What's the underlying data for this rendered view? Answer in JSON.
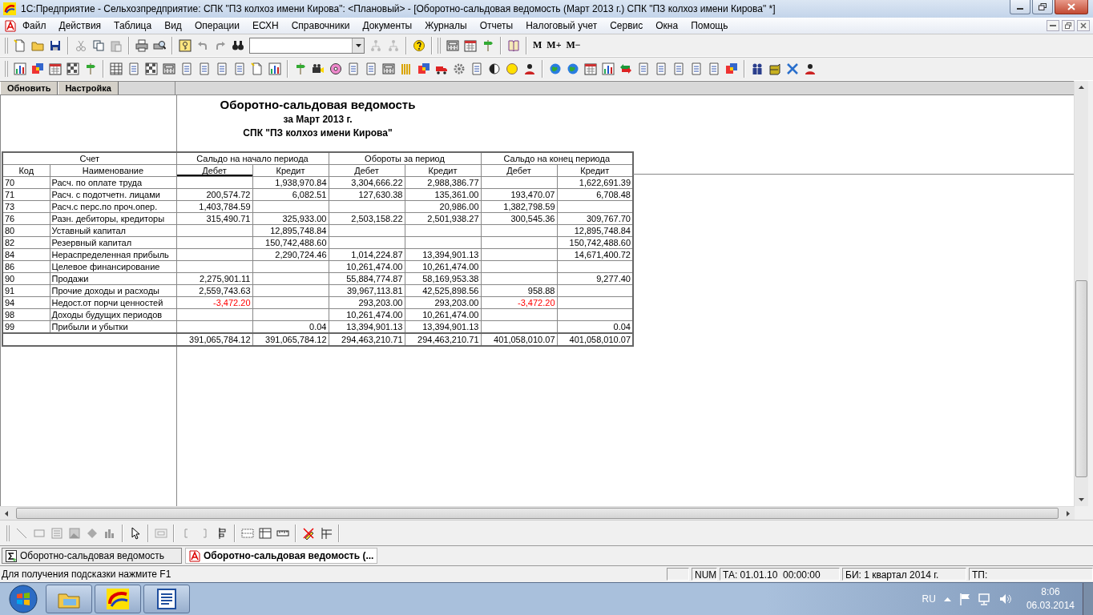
{
  "window": {
    "title": "1С:Предприятие - Сельхозпредприятие: СПК \"ПЗ колхоз имени Кирова\": <Плановый> - [Оборотно-сальдовая ведомость (Март 2013 г.) СПК \"ПЗ колхоз имени Кирова\"  *]"
  },
  "menu": [
    "Файл",
    "Действия",
    "Таблица",
    "Вид",
    "Операции",
    "ЕСХН",
    "Справочники",
    "Документы",
    "Журналы",
    "Отчеты",
    "Налоговый учет",
    "Сервис",
    "Окна",
    "Помощь"
  ],
  "memory_buttons": [
    "M",
    "M+",
    "M−"
  ],
  "report_buttons": [
    "Обновить",
    "Настройка"
  ],
  "report": {
    "title": "Оборотно-сальдовая ведомость",
    "period": "за Март 2013 г.",
    "organization": "СПК \"ПЗ колхоз имени Кирова\"",
    "header_groups": [
      "Счет",
      "Сальдо на начало периода",
      "Обороты за период",
      "Сальдо на конец периода"
    ],
    "columns": [
      {
        "label": "Код",
        "selected": false
      },
      {
        "label": "Наименование",
        "selected": false
      },
      {
        "label": "Дебет",
        "selected": true
      },
      {
        "label": "Кредит",
        "selected": false
      },
      {
        "label": "Дебет",
        "selected": false
      },
      {
        "label": "Кредит",
        "selected": false
      },
      {
        "label": "Дебет",
        "selected": false
      },
      {
        "label": "Кредит",
        "selected": false
      }
    ],
    "rows": [
      {
        "code": "70",
        "name": "Расч. по оплате труда",
        "opening_credit": "1,938,970.84",
        "turnover_debit": "3,304,666.22",
        "turnover_credit": "2,988,386.77",
        "closing_credit": "1,622,691.39"
      },
      {
        "code": "71",
        "name": "Расч. с подотчетн. лицами",
        "opening_debit": "200,574.72",
        "opening_credit": "6,082.51",
        "turnover_debit": "127,630.38",
        "turnover_credit": "135,361.00",
        "closing_debit": "193,470.07",
        "closing_credit": "6,708.48"
      },
      {
        "code": "73",
        "name": "Расч.с перс.по проч.опер.",
        "opening_debit": "1,403,784.59",
        "turnover_credit": "20,986.00",
        "closing_debit": "1,382,798.59"
      },
      {
        "code": "76",
        "name": "Разн. дебиторы, кредиторы",
        "opening_debit": "315,490.71",
        "opening_credit": "325,933.00",
        "turnover_debit": "2,503,158.22",
        "turnover_credit": "2,501,938.27",
        "closing_debit": "300,545.36",
        "closing_credit": "309,767.70"
      },
      {
        "code": "80",
        "name": "Уставный капитал",
        "opening_credit": "12,895,748.84",
        "closing_credit": "12,895,748.84"
      },
      {
        "code": "82",
        "name": "Резервный капитал",
        "opening_credit": "150,742,488.60",
        "closing_credit": "150,742,488.60"
      },
      {
        "code": "84",
        "name": "Нераспределенная прибыль",
        "opening_credit": "2,290,724.46",
        "turnover_debit": "1,014,224.87",
        "turnover_credit": "13,394,901.13",
        "closing_credit": "14,671,400.72"
      },
      {
        "code": "86",
        "name": "Целевое финансирование",
        "turnover_debit": "10,261,474.00",
        "turnover_credit": "10,261,474.00"
      },
      {
        "code": "90",
        "name": "Продажи",
        "opening_debit": "2,275,901.11",
        "turnover_debit": "55,884,774.87",
        "turnover_credit": "58,169,953.38",
        "closing_credit": "9,277.40"
      },
      {
        "code": "91",
        "name": "Прочие доходы и расходы",
        "opening_debit": "2,559,743.63",
        "turnover_debit": "39,967,113.81",
        "turnover_credit": "42,525,898.56",
        "closing_debit": "958.88"
      },
      {
        "code": "94",
        "name": "Недост.от порчи ценностей",
        "opening_debit": "-3,472.20",
        "turnover_debit": "293,203.00",
        "turnover_credit": "293,203.00",
        "closing_debit": "-3,472.20",
        "negative": {
          "opening_debit": true,
          "closing_debit": true
        }
      },
      {
        "code": "98",
        "name": "Доходы будущих периодов",
        "turnover_debit": "10,261,474.00",
        "turnover_credit": "10,261,474.00"
      },
      {
        "code": "99",
        "name": "Прибыли и убытки",
        "opening_credit": "0.04",
        "turnover_debit": "13,394,901.13",
        "turnover_credit": "13,394,901.13",
        "closing_credit": "0.04"
      }
    ],
    "totals": [
      "391,065,784.12",
      "391,065,784.12",
      "294,463,210.71",
      "294,463,210.71",
      "401,058,010.07",
      "401,058,010.07"
    ]
  },
  "window_tabs": [
    {
      "label": "Оборотно-сальдовая ведомость",
      "selected": false
    },
    {
      "label": "Оборотно-сальдовая ведомость (...",
      "selected": true
    }
  ],
  "status_bar": {
    "hint": "Для получения подсказки нажмите F1",
    "fields": [
      "NUM",
      "ТА: 01.01.10  00:00:00",
      "БИ: 1 квартал 2014 г.",
      "ТП:"
    ]
  },
  "taskbar": {
    "language": "RU",
    "time": "8:06",
    "date": "06.03.2014"
  }
}
